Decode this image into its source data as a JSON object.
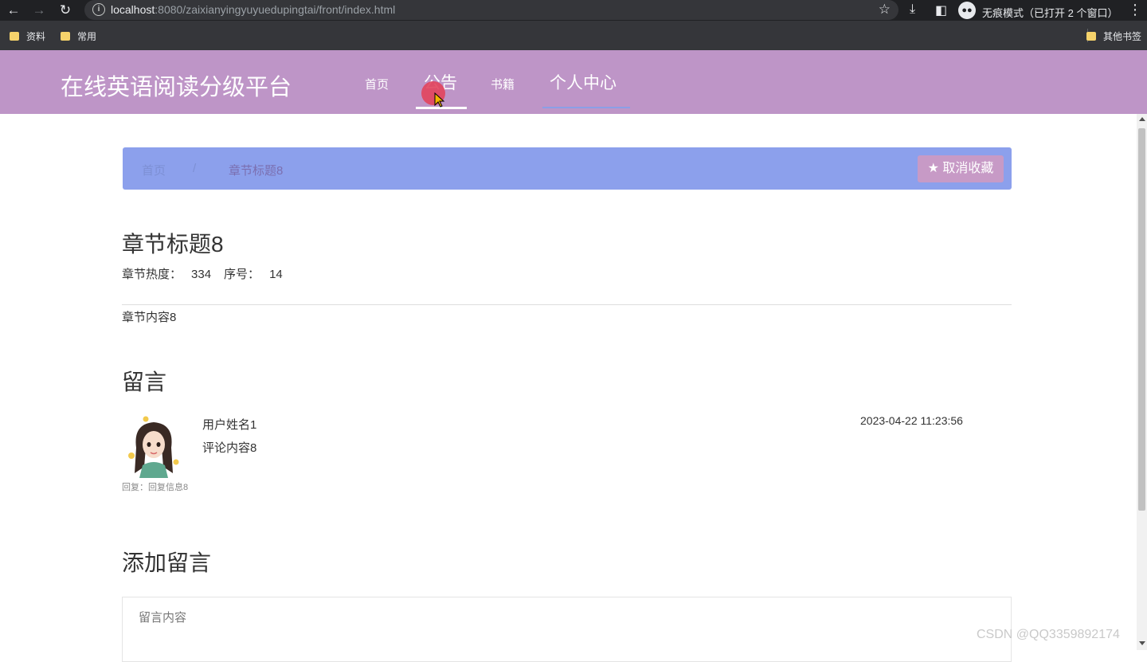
{
  "browser": {
    "url_host": "localhost",
    "url_rest": ":8080/zaixianyingyuyuedupingtai/front/index.html",
    "incognito_label": "无痕模式（已打开 2 个窗口）",
    "bookmarks": [
      "资料",
      "常用"
    ],
    "other_bookmarks": "其他书签"
  },
  "site": {
    "title": "在线英语阅读分级平台",
    "nav": [
      "首页",
      "公告",
      "书籍",
      "个人中心"
    ],
    "active_nav": "公告"
  },
  "breadcrumb": {
    "home": "首页",
    "separator": "/",
    "current": "章节标题8",
    "favorite_button": "取消收藏"
  },
  "chapter": {
    "title": "章节标题8",
    "heat_label": "章节热度：",
    "heat_value": "334",
    "index_label": "序号：",
    "index_value": "14",
    "content": "章节内容8"
  },
  "comments": {
    "section_title": "留言",
    "items": [
      {
        "user": "用户姓名1",
        "text": "评论内容8",
        "time": "2023-04-22 11:23:56",
        "reply": "回复：回复信息8"
      }
    ]
  },
  "add_comment": {
    "section_title": "添加留言",
    "placeholder": "留言内容"
  },
  "watermark": "CSDN @QQ3359892174",
  "colors": {
    "header_bg": "#be95c7",
    "breadcrumb_bg": "#8ca0ec",
    "favorite_button_bg": "#c79ac6"
  }
}
